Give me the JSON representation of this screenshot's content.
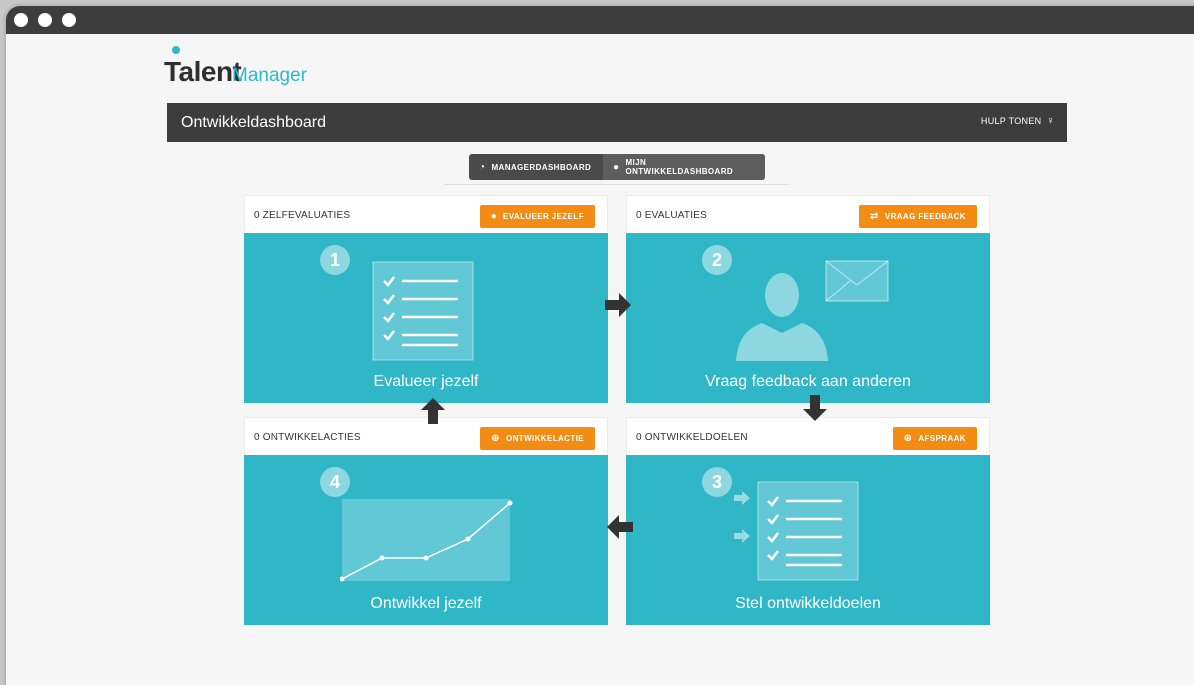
{
  "app": {
    "logo_main": "Talent",
    "logo_sub": "Manager"
  },
  "topbar": {
    "title": "Ontwikkeldashboard",
    "help_label": "HULP TONEN",
    "help_icon": "lightbulb-icon"
  },
  "dashboard_switch": {
    "manager_label": "MANAGERDASHBOARD",
    "manager_icon": "dashboard-icon",
    "mine_label": "MIJN ONTWIKKELDASHBOARD",
    "mine_icon": "user-icon",
    "active": "mine"
  },
  "cards": {
    "self_eval": {
      "count": "0 ZELFEVALUATIES",
      "button": "EVALUEER JEZELF",
      "button_icon": "user-icon",
      "step": "1",
      "label": "Evalueer jezelf"
    },
    "feedback": {
      "count": "0 EVALUATIES",
      "button": "VRAAG FEEDBACK",
      "button_icon": "exchange-icon",
      "step": "2",
      "label": "Vraag feedback aan anderen"
    },
    "actions": {
      "count": "0 ONTWIKKELACTIES",
      "button": "ONTWIKKELACTIE",
      "button_icon": "plus-circle-icon",
      "step": "4",
      "label": "Ontwikkel jezelf"
    },
    "goals": {
      "count": "0 ONTWIKKELDOELEN",
      "button": "AFSPRAAK",
      "button_icon": "plus-circle-icon",
      "step": "3",
      "label": "Stel ontwikkeldoelen"
    }
  },
  "colors": {
    "accent": "#f28c14",
    "teal": "#2fb6c7",
    "dark": "#3d3d3d"
  }
}
